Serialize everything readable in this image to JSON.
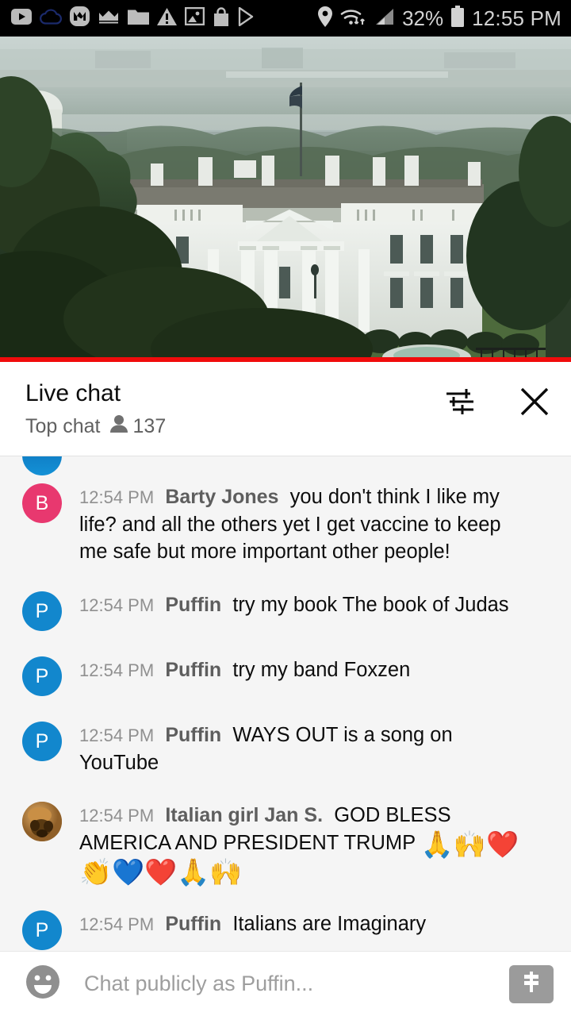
{
  "status_bar": {
    "left_icons": [
      {
        "name": "youtube-icon"
      },
      {
        "name": "cloud-icon"
      },
      {
        "name": "mega-icon"
      },
      {
        "name": "crown-icon"
      },
      {
        "name": "folder-icon"
      },
      {
        "name": "warning-icon"
      },
      {
        "name": "photos-icon"
      },
      {
        "name": "shopping-bag-icon"
      },
      {
        "name": "play-store-icon"
      }
    ],
    "right_icons": [
      {
        "name": "location-icon"
      },
      {
        "name": "wifi-icon"
      },
      {
        "name": "signal-icon"
      }
    ],
    "battery_percent": "32%",
    "time": "12:55 PM"
  },
  "video": {
    "name": "white-house-live-stream",
    "progress_percent": 100,
    "progress_color": "#f00c0c"
  },
  "chat_header": {
    "title": "Live chat",
    "mode": "Top chat",
    "viewer_count": "137",
    "settings_icon": "tune-icon",
    "close_icon": "close-icon"
  },
  "messages": [
    {
      "avatar_letter": "B",
      "avatar_color": "#e8386f",
      "avatar_type": "letter",
      "time": "12:54 PM",
      "author": "Barty Jones",
      "text": "you don't think I like my life? and all the others yet I get vaccine to keep me safe but more important other people!",
      "emojis": ""
    },
    {
      "avatar_letter": "P",
      "avatar_color": "#1287cd",
      "avatar_type": "letter",
      "time": "12:54 PM",
      "author": "Puffin",
      "text": "try my book The book of Judas",
      "emojis": ""
    },
    {
      "avatar_letter": "P",
      "avatar_color": "#1287cd",
      "avatar_type": "letter",
      "time": "12:54 PM",
      "author": "Puffin",
      "text": "try my band Foxzen",
      "emojis": ""
    },
    {
      "avatar_letter": "P",
      "avatar_color": "#1287cd",
      "avatar_type": "letter",
      "time": "12:54 PM",
      "author": "Puffin",
      "text": "WAYS OUT is a song on YouTube",
      "emojis": ""
    },
    {
      "avatar_letter": "",
      "avatar_color": "#b68446",
      "avatar_type": "photo",
      "time": "12:54 PM",
      "author": "Italian girl Jan S.",
      "text": "GOD BLESS AMERICA AND PRESIDENT TRUMP ",
      "emojis": "🙏🙌❤️👏💙❤️🙏🙌"
    },
    {
      "avatar_letter": "P",
      "avatar_color": "#1287cd",
      "avatar_type": "letter",
      "time": "12:54 PM",
      "author": "Puffin",
      "text": "Italians are Imaginary",
      "emojis": ""
    }
  ],
  "input_bar": {
    "emoji_icon": "emoji-smiley-icon",
    "placeholder": "Chat publicly as Puffin...",
    "superchat_icon": "dollar-bill-icon"
  }
}
